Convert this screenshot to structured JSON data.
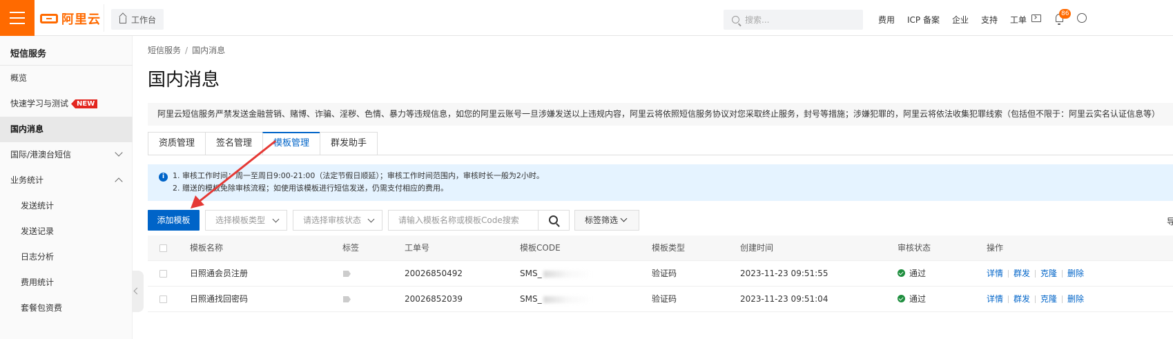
{
  "topbar": {
    "logo_text": "阿里云",
    "workbench": "工作台",
    "search_placeholder": "搜索...",
    "links": [
      "费用",
      "ICP 备案",
      "企业",
      "支持",
      "工单"
    ],
    "notification_count": "86"
  },
  "sidebar": {
    "title": "短信服务",
    "items": [
      {
        "label": "概览"
      },
      {
        "label": "快速学习与测试",
        "tag": "NEW"
      },
      {
        "label": "国内消息"
      },
      {
        "label": "国际/港澳台短信"
      },
      {
        "label": "业务统计"
      },
      {
        "label": "发送统计"
      },
      {
        "label": "发送记录"
      },
      {
        "label": "日志分析"
      },
      {
        "label": "费用统计"
      },
      {
        "label": "套餐包资费"
      }
    ]
  },
  "breadcrumb": {
    "root": "短信服务",
    "sep": "/",
    "current": "国内消息"
  },
  "page_title": "国内消息",
  "notice": "阿里云短信服务严禁发送金融营销、赌博、诈骗、淫秽、色情、暴力等违规信息，如您的阿里云账号一旦涉嫌发送以上违规内容，阿里云将依照短信服务协议对您采取终止服务，封号等措施；涉嫌犯罪的，阿里云将依法收集犯罪线索（包括但不限于：阿里云实名认证信息等）",
  "tabs": [
    "资质管理",
    "签名管理",
    "模板管理",
    "群发助手"
  ],
  "info": {
    "line1": "1. 审核工作时间：周一至周日9:00-21:00（法定节假日顺延）；审核工作时间范围内，审核时长一般为2小时。",
    "line2": "2. 赠送的模板免除审核流程；如使用该模板进行短信发送，仍需支付相应的费用。"
  },
  "toolbar": {
    "add_button": "添加模板",
    "type_placeholder": "选择模板类型",
    "status_placeholder": "请选择审核状态",
    "search_placeholder": "请输入模板名称或模板Code搜索",
    "tag_filter": "标签筛选",
    "edge_text": "导"
  },
  "table": {
    "headers": [
      "模板名称",
      "标签",
      "工单号",
      "模板CODE",
      "模板类型",
      "创建时间",
      "审核状态",
      "操作"
    ],
    "rows": [
      {
        "name": "日照通会员注册",
        "ticket": "20026850492",
        "code": "SMS_",
        "type": "验证码",
        "created": "2023-11-23 09:51:55",
        "status": "通过",
        "actions": [
          "详情",
          "群发",
          "克隆",
          "删除"
        ]
      },
      {
        "name": "日照通找回密码",
        "ticket": "20026852039",
        "code": "SMS_",
        "type": "验证码",
        "created": "2023-11-23 09:51:04",
        "status": "通过",
        "actions": [
          "详情",
          "群发",
          "克隆",
          "删除"
        ]
      }
    ]
  },
  "colors": {
    "brand": "#ff6a00",
    "primary": "#0064c8",
    "annotation_arrow": "#e53935",
    "status_ok": "#1e8e3e"
  }
}
